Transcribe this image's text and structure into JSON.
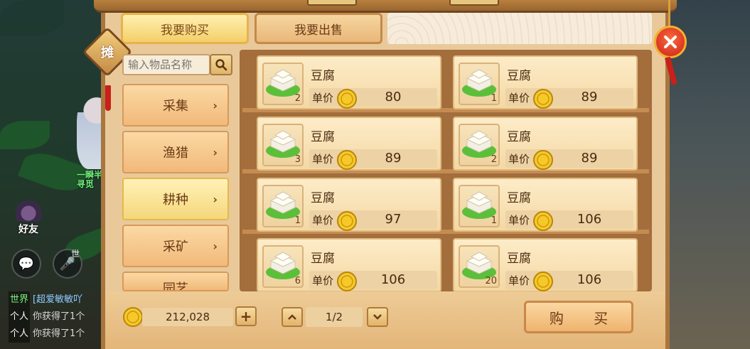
{
  "tabs": {
    "buy_label": "我要购买",
    "sell_label": "我要出售"
  },
  "stall_badge": "摊",
  "search": {
    "placeholder": "输入物品名称",
    "button_icon": "search-icon"
  },
  "categories": [
    {
      "label": "采集",
      "active": false
    },
    {
      "label": "渔猎",
      "active": false
    },
    {
      "label": "耕种",
      "active": true
    },
    {
      "label": "采矿",
      "active": false
    },
    {
      "label": "园艺",
      "active": false
    }
  ],
  "price_label": "单价",
  "items": [
    {
      "name": "豆腐",
      "qty": "2",
      "price": "80"
    },
    {
      "name": "豆腐",
      "qty": "1",
      "price": "89"
    },
    {
      "name": "豆腐",
      "qty": "3",
      "price": "89"
    },
    {
      "name": "豆腐",
      "qty": "2",
      "price": "89"
    },
    {
      "name": "豆腐",
      "qty": "1",
      "price": "97"
    },
    {
      "name": "豆腐",
      "qty": "1",
      "price": "106"
    },
    {
      "name": "豆腐",
      "qty": "6",
      "price": "106"
    },
    {
      "name": "豆腐",
      "qty": "20",
      "price": "106"
    }
  ],
  "footer": {
    "money": "212,028",
    "page": "1/2",
    "buy_label": "购 买"
  },
  "game_overlay": {
    "npc_name_line1": "一瞬半",
    "npc_name_line2": "寻觅",
    "friends_label": "好友",
    "voice_tag": "世",
    "chat": [
      {
        "channel": "世界",
        "text": "[超爱敏敏吖"
      },
      {
        "channel": "个人",
        "text": "你获得了1个"
      },
      {
        "channel": "个人",
        "text": "你获得了1个"
      }
    ]
  },
  "colors": {
    "frame": "#a8763e",
    "panel": "#e9c99a",
    "shelf": "#a36e3c",
    "active_tab": "#f4cf6a",
    "close": "#c8201a"
  }
}
